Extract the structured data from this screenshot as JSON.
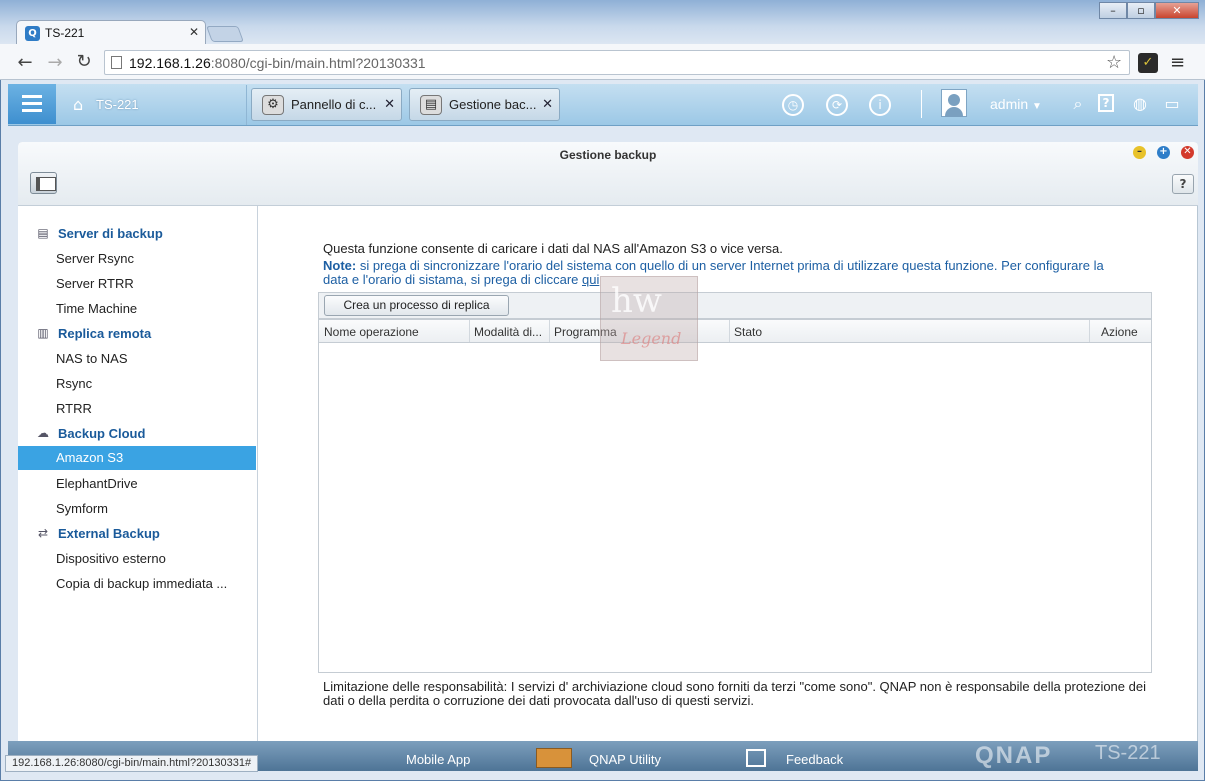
{
  "browser": {
    "tab_title": "TS-221",
    "tab_favicon": "Q",
    "url_host": "192.168.1.26",
    "url_rest": ":8080/cgi-bin/main.html?20130331",
    "status_url": "192.168.1.26:8080/cgi-bin/main.html?20130331#"
  },
  "qts": {
    "device_name": "TS-221",
    "tabs": [
      {
        "label": "Pannello di c...",
        "icon": "gear-icon"
      },
      {
        "label": "Gestione bac...",
        "icon": "backup-icon"
      }
    ],
    "user": "admin",
    "top_icons": [
      "clock-icon",
      "sync-icon",
      "info-icon"
    ],
    "right_icons": [
      "search-icon",
      "help-icon",
      "globe-icon",
      "monitor-icon"
    ]
  },
  "app": {
    "title": "Gestione backup",
    "help_label": "?",
    "sidebar": {
      "groups": [
        {
          "label": "Server di backup",
          "icon": "server-icon",
          "items": [
            "Server Rsync",
            "Server RTRR",
            "Time Machine"
          ]
        },
        {
          "label": "Replica remota",
          "icon": "replica-icon",
          "items": [
            "NAS to NAS",
            "Rsync",
            "RTRR"
          ]
        },
        {
          "label": "Backup Cloud",
          "icon": "cloud-icon",
          "items": [
            "Amazon S3",
            "ElephantDrive",
            "Symform"
          ]
        },
        {
          "label": "External Backup",
          "icon": "refresh-icon",
          "items": [
            "Dispositivo esterno",
            "Copia di backup immediata ..."
          ]
        }
      ],
      "selected": "Amazon S3"
    },
    "content": {
      "description": "Questa funzione consente di caricare i dati dal NAS all'Amazon S3 o vice versa.",
      "note_label": "Note:",
      "note_text": " si prega di sincronizzare l'orario del sistema con quello di un server Internet prima di utilizzare questa funzione. Per configurare la data e l'orario di sistama, si prega di cliccare ",
      "note_link": "qui",
      "create_button": "Crea un processo di replica",
      "columns": [
        "Nome operazione",
        "Modalità di...",
        "Programma",
        "Stato",
        "Azione"
      ],
      "watermark": "hw",
      "watermark_script": "Legend",
      "disclaimer": "Limitazione delle responsabilità: I servizi d' archiviazione cloud sono forniti da terzi \"come sono\". QNAP non è responsabile della protezione dei dati o della perdita o corruzione dei dati provocata dall'uso di questi servizi."
    }
  },
  "dock": {
    "items": [
      "Mobile App",
      "QNAP Utility",
      "Feedback"
    ],
    "brand": "QNAP",
    "model": "TS-221"
  },
  "colors": {
    "accent": "#3aa3e3",
    "link": "#1d5fa3"
  }
}
